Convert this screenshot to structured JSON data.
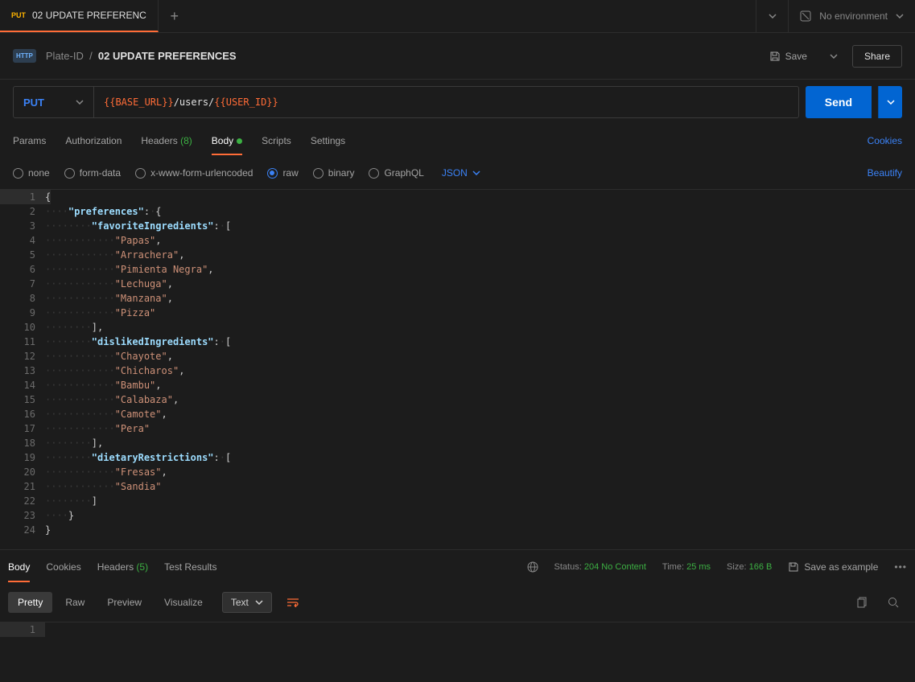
{
  "tab": {
    "method": "PUT",
    "title": "02 UPDATE PREFERENC"
  },
  "env": {
    "label": "No environment"
  },
  "breadcrumb": {
    "parent": "Plate-ID",
    "current": "02 UPDATE PREFERENCES"
  },
  "actions": {
    "save": "Save",
    "share": "Share",
    "send": "Send"
  },
  "method": {
    "value": "PUT"
  },
  "url": {
    "var1": "{{BASE_URL}}",
    "mid": "/users/",
    "var2": "{{USER_ID}}"
  },
  "req_tabs": {
    "params": "Params",
    "auth": "Authorization",
    "headers": "Headers",
    "headers_count": "(8)",
    "body": "Body",
    "scripts": "Scripts",
    "settings": "Settings",
    "cookies": "Cookies"
  },
  "body_types": {
    "none": "none",
    "formdata": "form-data",
    "urlenc": "x-www-form-urlencoded",
    "raw": "raw",
    "binary": "binary",
    "graphql": "GraphQL",
    "json": "JSON",
    "beautify": "Beautify"
  },
  "code": {
    "preferences_key": "\"preferences\"",
    "fav_key": "\"favoriteIngredients\"",
    "fav": [
      "\"Papas\"",
      "\"Arrachera\"",
      "\"Pimienta Negra\"",
      "\"Lechuga\"",
      "\"Manzana\"",
      "\"Pizza\""
    ],
    "dis_key": "\"dislikedIngredients\"",
    "dis": [
      "\"Chayote\"",
      "\"Chicharos\"",
      "\"Bambu\"",
      "\"Calabaza\"",
      "\"Camote\"",
      "\"Pera\""
    ],
    "diet_key": "\"dietaryRestrictions\"",
    "diet": [
      "\"Fresas\"",
      "\"Sandia\""
    ]
  },
  "resp_tabs": {
    "body": "Body",
    "cookies": "Cookies",
    "headers": "Headers",
    "headers_count": "(5)",
    "tests": "Test Results"
  },
  "resp_meta": {
    "status_label": "Status:",
    "status_code": "204",
    "status_text": "No Content",
    "time_label": "Time:",
    "time_val": "25 ms",
    "size_label": "Size:",
    "size_val": "166 B",
    "save_example": "Save as example"
  },
  "resp_view": {
    "pretty": "Pretty",
    "raw": "Raw",
    "preview": "Preview",
    "visualize": "Visualize",
    "text": "Text"
  }
}
